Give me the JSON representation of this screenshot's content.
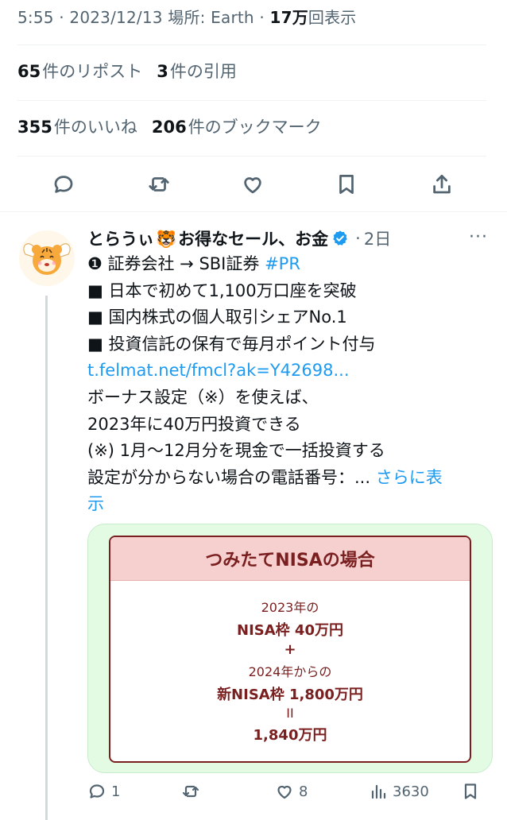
{
  "meta": {
    "time": "5:55",
    "sep1": " · ",
    "date": "2023/12/13",
    "location_label": "場所: Earth",
    "sep2": " · ",
    "views_count": "17万",
    "views_label": "回表示"
  },
  "stats": {
    "reposts_count": "65",
    "reposts_label": "件のリポスト",
    "quotes_count": "3",
    "quotes_label": "件の引用",
    "likes_count": "355",
    "likes_label": "件のいいね",
    "bookmarks_count": "206",
    "bookmarks_label": "件のブックマーク"
  },
  "actions": {
    "icons": [
      "reply-icon",
      "repost-icon",
      "like-icon",
      "bookmark-icon",
      "share-icon"
    ]
  },
  "reply": {
    "author_name": "とらうぃ",
    "tiger_emoji": "🐯",
    "author_suffix": "お得なセール、お金",
    "dot": "·",
    "time_ago": "2日",
    "more": "···",
    "line1_prefix": "❶ 証券会社 → SBI証券 ",
    "line1_hashtag": "#PR",
    "line2": "■ 日本で初めて1,100万口座を突破",
    "line3": "■ 国内株式の個人取引シェアNo.1",
    "line4": "■ 投資信託の保有で毎月ポイント付与",
    "link": "t.felmat.net/fmcl?ak=Y42698...",
    "line6": "ボーナス設定（※）を使えば、",
    "line7": "2023年に40万円投資できる",
    "line8": "(※) 1月〜12月分を現金で一括投資する",
    "line9": "設定が分からない場合の電話番号：... ",
    "show_more_a": "さらに表",
    "show_more_b": "示",
    "card": {
      "title": "つみたてNISAの場合",
      "l1": "2023年の",
      "l2": "NISA枠 40万円",
      "plus": "+",
      "l3": "2024年からの",
      "l4": "新NISA枠 1,800万円",
      "eq": "II",
      "l5": "1,840万円"
    },
    "replies": "1",
    "reposts": "",
    "likes": "8",
    "views": "3630"
  },
  "colors": {
    "link": "#1d9bf0",
    "muted": "#536471",
    "verified": "#1d9bf0",
    "card_bg": "#e3fbe3",
    "card_accent": "#7a1f1f"
  }
}
